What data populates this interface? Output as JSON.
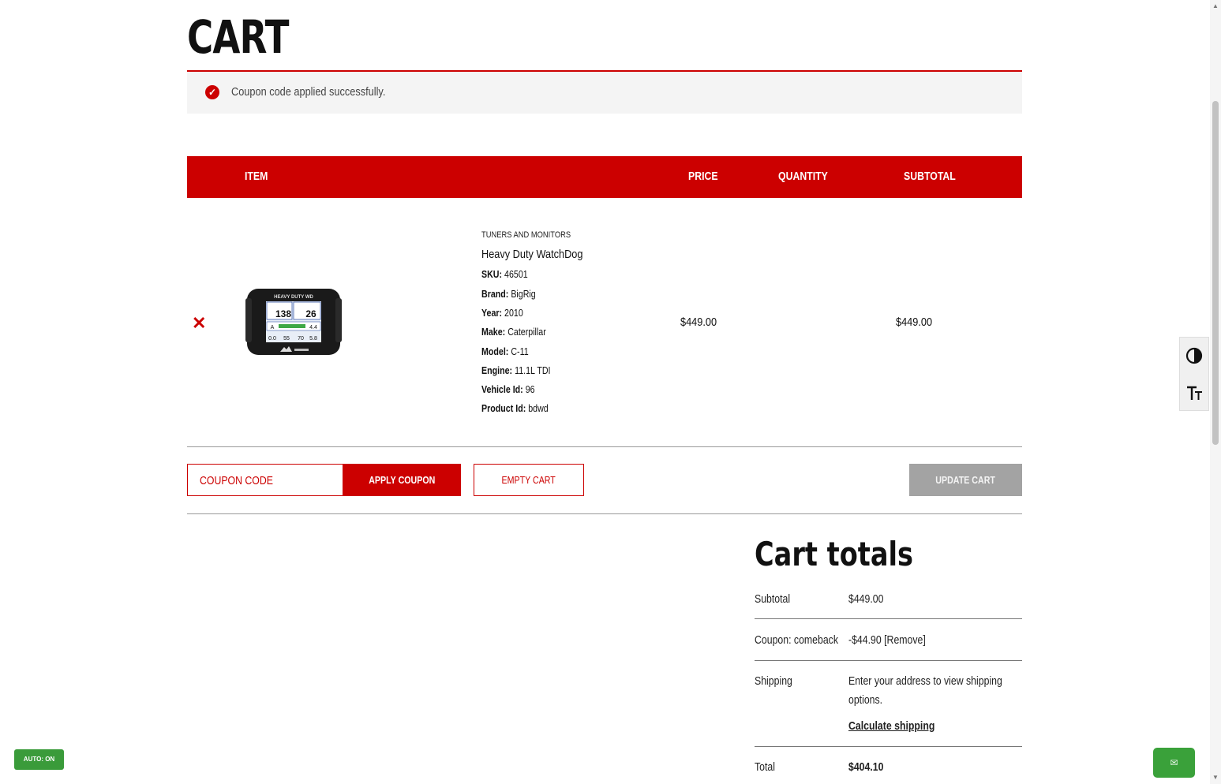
{
  "page": {
    "title": "CART"
  },
  "notice": {
    "message": "Coupon code applied successfully.",
    "icon": "check-circle-icon",
    "accent_color": "#cc0000"
  },
  "table": {
    "headers": {
      "item": "ITEM",
      "price": "PRICE",
      "quantity": "QUANTITY",
      "subtotal": "SUBTOTAL"
    },
    "header_color": "#cc0000"
  },
  "cart_item": {
    "remove_icon": "close-icon",
    "category": "TUNERS AND MONITORS",
    "name": "Heavy Duty WatchDog",
    "image_text": {
      "header": "HEAVY DUTY WD",
      "gauge_1": "138",
      "gauge_2": "26",
      "bar_left": "A",
      "bar_right": "4.4",
      "bottom_1": "0.0",
      "bottom_2": "55",
      "bottom_3": "70",
      "bottom_4": "5.8"
    },
    "attributes": [
      {
        "label": "SKU:",
        "value": "46501"
      },
      {
        "label": "Brand:",
        "value": "BigRig"
      },
      {
        "label": "Year:",
        "value": "2010"
      },
      {
        "label": "Make:",
        "value": "Caterpillar"
      },
      {
        "label": "Model:",
        "value": "C-11"
      },
      {
        "label": "Engine:",
        "value": "11.1L TDI"
      },
      {
        "label": "Vehicle Id:",
        "value": "96"
      },
      {
        "label": "Product Id:",
        "value": "bdwd"
      }
    ],
    "price": "$449.00",
    "subtotal": "$449.00"
  },
  "actions": {
    "coupon_placeholder": "COUPON CODE",
    "apply_coupon": "APPLY COUPON",
    "empty_cart": "EMPTY CART",
    "update_cart": "UPDATE CART"
  },
  "totals": {
    "heading": "Cart totals",
    "subtotal_label": "Subtotal",
    "subtotal_value": "$449.00",
    "coupon_label": "Coupon: comeback",
    "coupon_value": "-$44.90",
    "coupon_remove": "[Remove]",
    "shipping_label": "Shipping",
    "shipping_text_1": "Enter your address to view shipping",
    "shipping_text_2": "options.",
    "calculate_shipping": "Calculate shipping",
    "total_label": "Total",
    "total_value": "$404.10"
  },
  "side_tools": {
    "contrast_icon": "contrast-icon",
    "font_size_icon": "text-size-icon"
  },
  "widgets": {
    "auto_badge": "AUTO: ON",
    "chat_icon": "chat-icon"
  }
}
